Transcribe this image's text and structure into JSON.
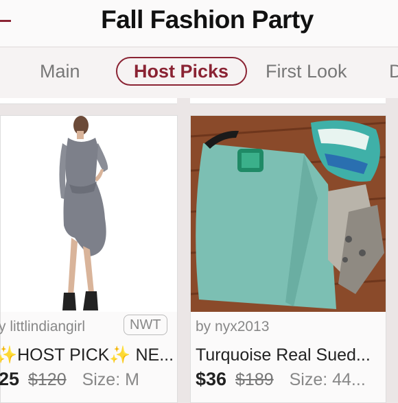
{
  "header": {
    "title": "Fall Fashion Party"
  },
  "tabs": [
    {
      "label": "Main",
      "active": false
    },
    {
      "label": "Host Picks",
      "active": true
    },
    {
      "label": "First Look",
      "active": false
    },
    {
      "label": "D",
      "active": false
    }
  ],
  "listings": [
    {
      "seller": "y littlindiangirl",
      "badge": "NWT",
      "title": "✨HOST PICK✨ NE...",
      "price": "25",
      "original_price": "$120",
      "size": "Size: M"
    },
    {
      "seller": "by nyx2013",
      "badge": "",
      "title": "Turquoise Real Sued...",
      "price": "$36",
      "original_price": "$189",
      "size": "Size: 44..."
    }
  ],
  "colors": {
    "accent": "#8a2333",
    "background": "#ebe6e6"
  }
}
